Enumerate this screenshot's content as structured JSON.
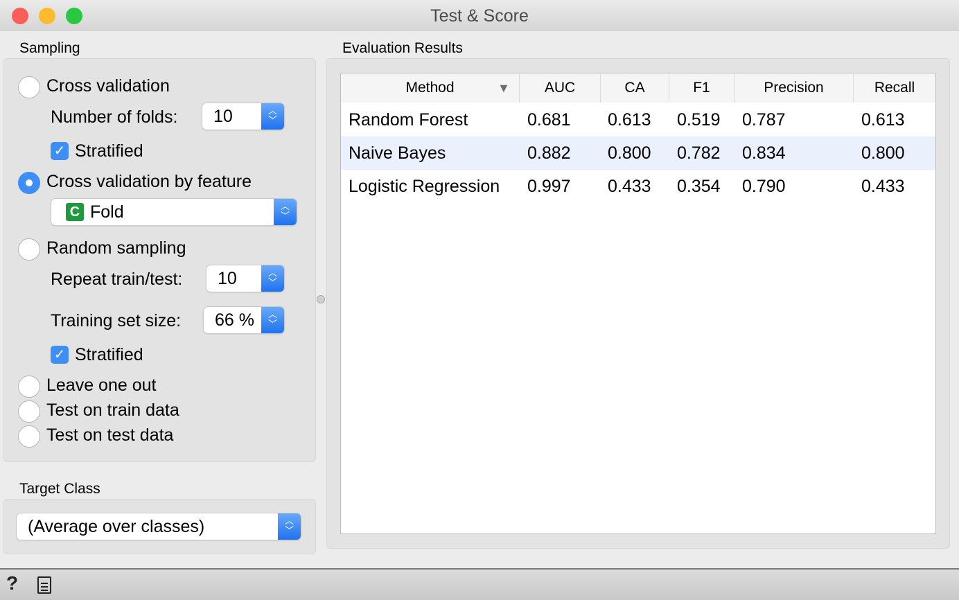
{
  "window": {
    "title": "Test & Score"
  },
  "sampling": {
    "label": "Sampling",
    "cross_validation": "Cross validation",
    "folds_label": "Number of folds:",
    "folds_value": "10",
    "stratified1": "Stratified",
    "cv_by_feature": "Cross validation by feature",
    "feature_icon": "C",
    "feature_value": "Fold",
    "random_sampling": "Random sampling",
    "repeat_label": "Repeat train/test:",
    "repeat_value": "10",
    "train_size_label": "Training set size:",
    "train_size_value": "66 %",
    "stratified2": "Stratified",
    "leave_one_out": "Leave one out",
    "test_on_train": "Test on train data",
    "test_on_test": "Test on test data",
    "selected": "Cross validation by feature"
  },
  "target": {
    "label": "Target Class",
    "value": "(Average over classes)"
  },
  "results": {
    "label": "Evaluation Results",
    "columns": [
      "Method",
      "AUC",
      "CA",
      "F1",
      "Precision",
      "Recall"
    ],
    "rows": [
      [
        "Random Forest",
        "0.681",
        "0.613",
        "0.519",
        "0.787",
        "0.613"
      ],
      [
        "Naive Bayes",
        "0.882",
        "0.800",
        "0.782",
        "0.834",
        "0.800"
      ],
      [
        "Logistic Regression",
        "0.997",
        "0.433",
        "0.354",
        "0.790",
        "0.433"
      ]
    ]
  },
  "colors": {
    "accent": "#3d8ff5",
    "selected_row": "#eaf1fc",
    "feature_icon": "#1e9a3c"
  }
}
